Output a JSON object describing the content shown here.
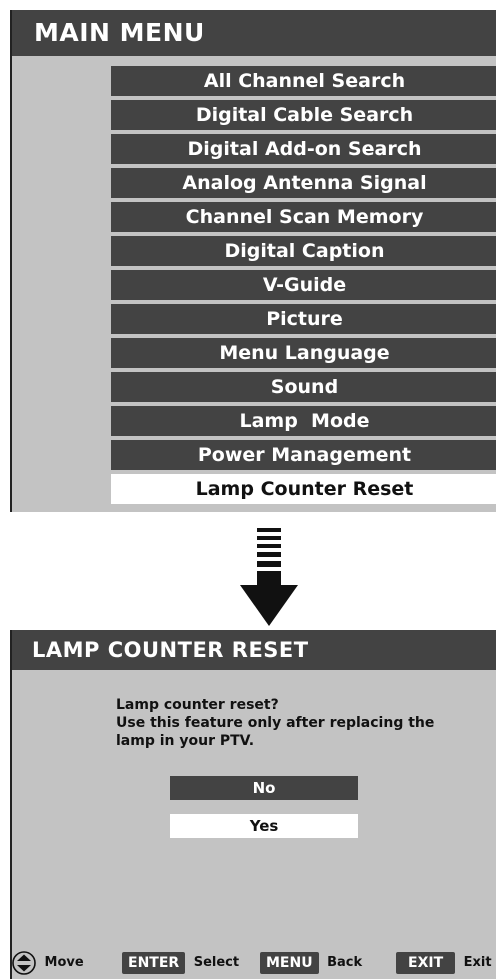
{
  "main_menu": {
    "title": "MAIN MENU",
    "items": [
      {
        "label": "All Channel Search"
      },
      {
        "label": "Digital Cable Search"
      },
      {
        "label": "Digital Add-on Search"
      },
      {
        "label": "Analog Antenna Signal"
      },
      {
        "label": "Channel Scan Memory"
      },
      {
        "label": "Digital Caption"
      },
      {
        "label": "V-Guide"
      },
      {
        "label": "Picture"
      },
      {
        "label": "Menu Language"
      },
      {
        "label": "Sound"
      },
      {
        "label": "Lamp  Mode"
      },
      {
        "label": "Power Management"
      },
      {
        "label": "Lamp Counter Reset",
        "selected": true
      }
    ]
  },
  "reset_dialog": {
    "title": "LAMP COUNTER RESET",
    "message_lines": [
      "Lamp counter reset?",
      "Use this feature only after replacing the",
      "lamp in your PTV."
    ],
    "options": {
      "no": "No",
      "yes": "Yes"
    },
    "selected_option": "Yes"
  },
  "hints": {
    "move": {
      "icon": "updown-arrows-icon",
      "label": "Move"
    },
    "enter": {
      "key": "ENTER",
      "label": "Select"
    },
    "menu": {
      "key": "MENU",
      "label": "Back"
    },
    "exit": {
      "key": "EXIT",
      "label": "Exit"
    }
  },
  "colors": {
    "panel_bg": "#c3c3c3",
    "bar_dark": "#434343",
    "highlight": "#ffffff",
    "text_light": "#ffffff",
    "text_dark": "#111111"
  }
}
